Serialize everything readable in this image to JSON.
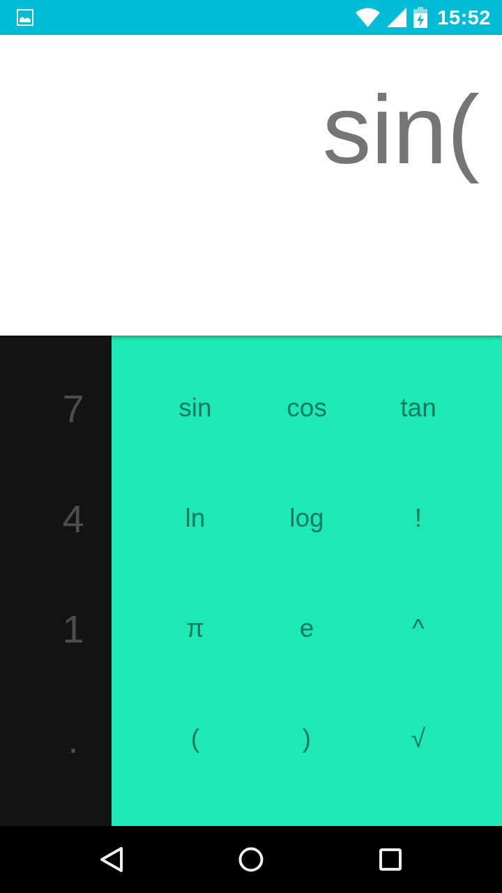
{
  "status_bar": {
    "time": "15:52"
  },
  "display": {
    "expression": "sin("
  },
  "digit_pad": {
    "keys": [
      "7",
      "4",
      "1",
      "."
    ]
  },
  "function_pad": {
    "keys": [
      "sin",
      "cos",
      "tan",
      "ln",
      "log",
      "!",
      "π",
      "e",
      "^",
      "(",
      ")",
      "√"
    ]
  }
}
